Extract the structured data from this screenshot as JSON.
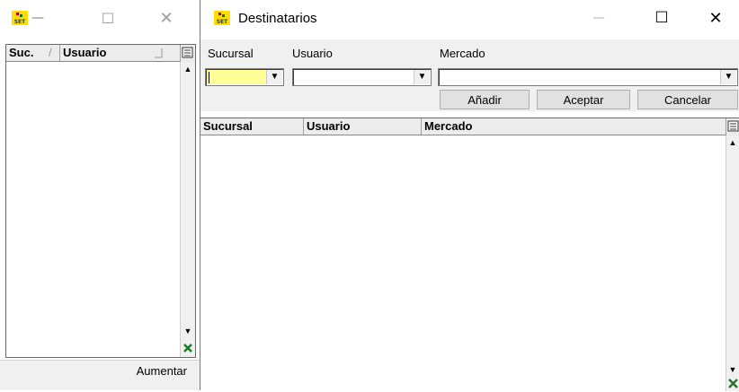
{
  "left_window": {
    "controls": {
      "minimize": "—",
      "maximize": "☐",
      "close": "✕"
    },
    "grid": {
      "columns": [
        "Suc.",
        "Usuario"
      ],
      "sort_indicator": "/"
    },
    "footer": {
      "button": "Aumentar"
    }
  },
  "main_window": {
    "title": "Destinatarios",
    "controls": {
      "minimize": "—",
      "maximize": "☐",
      "close": "✕"
    },
    "filters": {
      "sucursal_label": "Sucursal",
      "usuario_label": "Usuario",
      "mercado_label": "Mercado",
      "sucursal_value": "",
      "usuario_value": "",
      "mercado_value": ""
    },
    "buttons": {
      "add": "Añadir",
      "accept": "Aceptar",
      "cancel": "Cancelar"
    },
    "grid": {
      "columns": [
        "Sucursal",
        "Usuario",
        "Mercado"
      ]
    }
  }
}
